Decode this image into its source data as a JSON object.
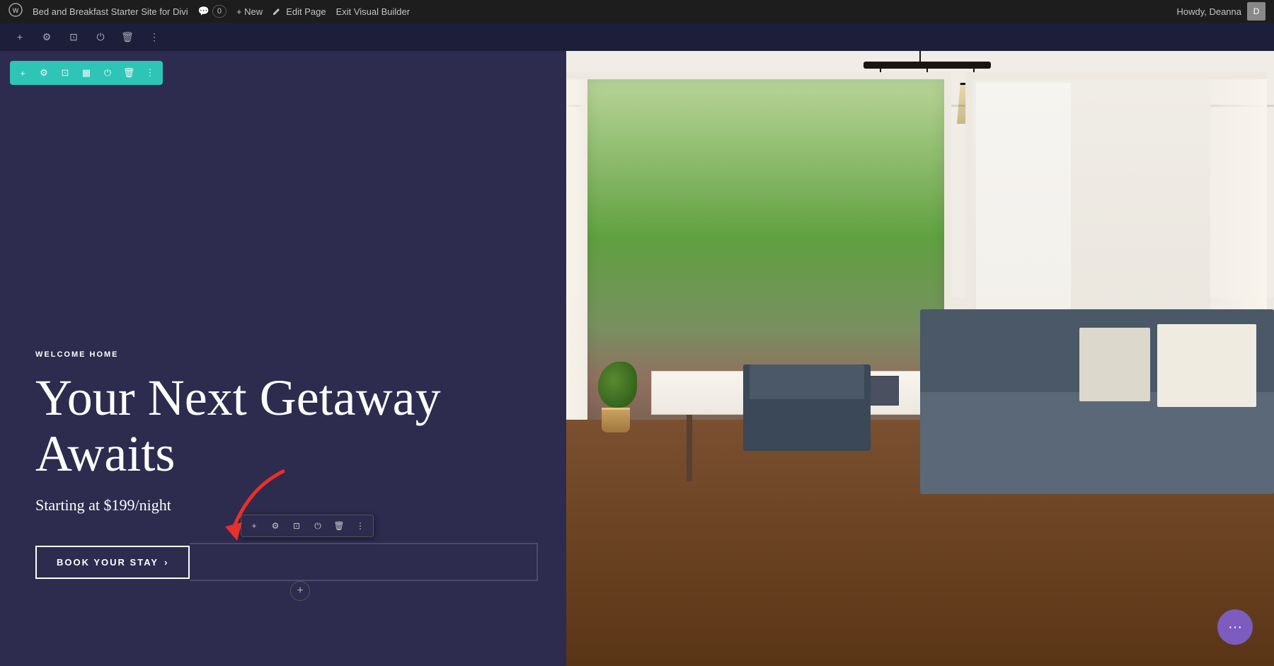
{
  "adminBar": {
    "wpLogo": "WP",
    "siteName": "Bed and Breakfast Starter Site for Divi",
    "comments": "0",
    "newLabel": "+ New",
    "editPage": "Edit Page",
    "exitBuilder": "Exit Visual Builder",
    "howdy": "Howdy, Deanna"
  },
  "diviBar": {
    "icons": [
      "+",
      "⚙",
      "⊡",
      "⏻",
      "🗑",
      "⋮"
    ]
  },
  "sectionToolbar": {
    "icons": [
      "+",
      "⚙",
      "⊡",
      "▦",
      "⏻",
      "🗑",
      "⋮"
    ]
  },
  "content": {
    "welcomeLabel": "WELCOME HOME",
    "headline": "Your Next Getaway Awaits",
    "subheadline": "Starting at $199/night"
  },
  "bookButton": {
    "label": "BOOK YOUR STAY",
    "arrow": "›"
  },
  "buttonToolbar": {
    "icons": [
      "+",
      "⚙",
      "⊡",
      "⏻",
      "🗑",
      "⋮"
    ]
  },
  "purpleDot": {
    "icon": "⋯"
  },
  "colors": {
    "darkBg": "#2d2b4e",
    "teal": "#2ec4b6",
    "purple": "#7c5cbf",
    "adminBg": "#1d1d1d"
  }
}
